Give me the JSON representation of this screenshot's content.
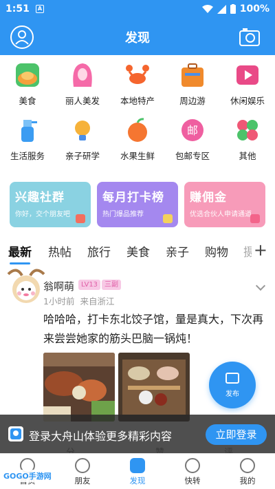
{
  "status_bar": {
    "time": "1:51",
    "notif_letter": "A",
    "battery": "100%"
  },
  "header": {
    "title": "发现"
  },
  "grid": [
    {
      "label": "美食",
      "icon": "roast-chicken-icon",
      "color": "#f4a13b"
    },
    {
      "label": "丽人美发",
      "icon": "woman-hair-icon",
      "color": "#f56aa8"
    },
    {
      "label": "本地特产",
      "icon": "crab-icon",
      "color": "#f5652e"
    },
    {
      "label": "周边游",
      "icon": "suitcase-icon",
      "color": "#f08a2c"
    },
    {
      "label": "休闲娱乐",
      "icon": "film-icon",
      "color": "#e94a87"
    },
    {
      "label": "生活服务",
      "icon": "spray-bottle-icon",
      "color": "#3b9cf2"
    },
    {
      "label": "亲子研学",
      "icon": "lightbulb-icon",
      "color": "#f6b23a"
    },
    {
      "label": "水果生鲜",
      "icon": "apple-icon",
      "color": "#f57631"
    },
    {
      "label": "包邮专区",
      "icon": "mail-badge-icon",
      "color": "#ef5fa0"
    },
    {
      "label": "其他",
      "icon": "clover-icon",
      "color": "#ef5876"
    }
  ],
  "banners": [
    {
      "title": "兴趣社群",
      "subtitle": "你好，交个朋友吧",
      "color": "#8ad2e2"
    },
    {
      "title": "每月打卡榜",
      "subtitle": "热门爆品推荐",
      "color": "#a488ef"
    },
    {
      "title": "赚佣金",
      "subtitle": "优选合伙人申请通道",
      "color": "#f79bb9"
    }
  ],
  "tabs": [
    "最新",
    "热帖",
    "旅行",
    "美食",
    "亲子",
    "购物",
    "摄"
  ],
  "post": {
    "author": "翁啊萌",
    "level": "LV13",
    "tag": "三副",
    "time": "1小时前",
    "location": "来自浙江",
    "text": "哈哈哈，打卡东北饺子馆，量是真大，下次再来尝尝她家的筋头巴脑一锅炖！"
  },
  "publish": {
    "label": "发布"
  },
  "actions": {
    "share": "分享",
    "like": "赞",
    "comment": "评论"
  },
  "login_bar": {
    "text": "登录大舟山体验更多精彩内容",
    "button": "立即登录"
  },
  "nav": [
    {
      "label": "首页",
      "icon": "home-icon"
    },
    {
      "label": "朋友",
      "icon": "friends-icon"
    },
    {
      "label": "发现",
      "icon": "discover-icon"
    },
    {
      "label": "快转",
      "icon": "location-icon"
    },
    {
      "label": "我的",
      "icon": "profile-icon"
    }
  ],
  "watermark": "GOGO手游网"
}
